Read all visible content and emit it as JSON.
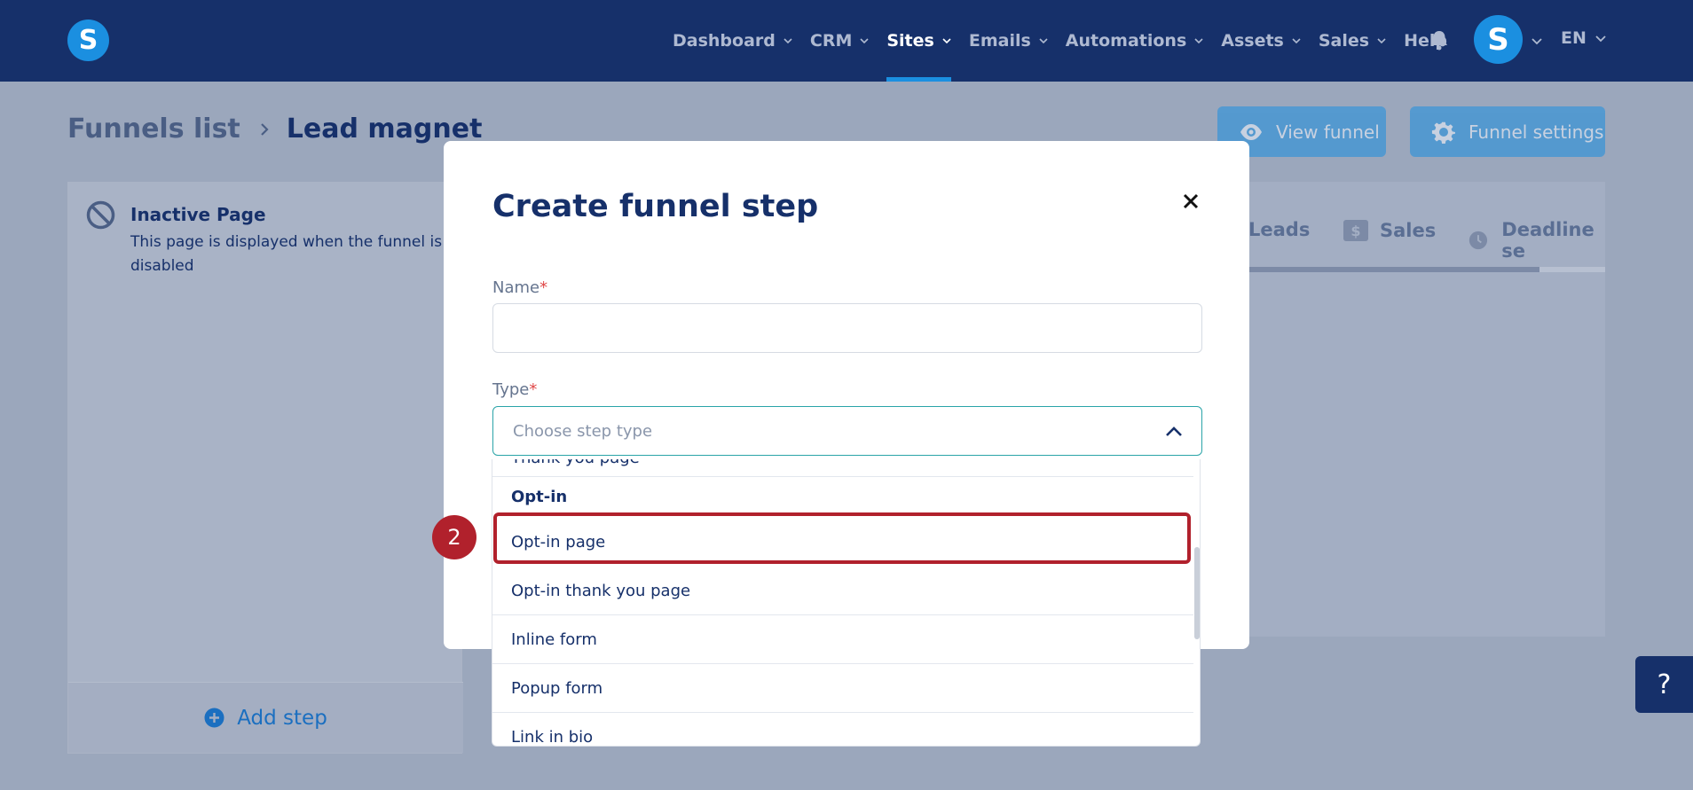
{
  "nav": {
    "items": [
      {
        "label": "Dashboard",
        "has_chevron": true
      },
      {
        "label": "CRM",
        "has_chevron": true
      },
      {
        "label": "Sites",
        "has_chevron": true,
        "active": true
      },
      {
        "label": "Emails",
        "has_chevron": true
      },
      {
        "label": "Automations",
        "has_chevron": true
      },
      {
        "label": "Assets",
        "has_chevron": true
      },
      {
        "label": "Sales",
        "has_chevron": true
      },
      {
        "label": "Help",
        "has_chevron": false
      }
    ],
    "logo_letter": "S",
    "avatar_letter": "S",
    "language": "EN",
    "icons": {
      "bell": "bell-icon"
    }
  },
  "breadcrumb": {
    "parent": "Funnels list",
    "current": "Lead magnet"
  },
  "header_buttons": {
    "view_funnel": "View funnel",
    "funnel_settings": "Funnel settings"
  },
  "left_panel": {
    "title": "Inactive Page",
    "description": "This page is displayed when the funnel is disabled",
    "add_step": "Add step"
  },
  "right_panel": {
    "tabs": [
      {
        "label": "Leads",
        "icon": "leads-icon"
      },
      {
        "label": "Sales",
        "icon": "dollar-icon"
      },
      {
        "label": "Deadline se",
        "icon": "clock-icon"
      }
    ]
  },
  "help_button": "?",
  "modal": {
    "title": "Create funnel step",
    "name_label": "Name",
    "type_label": "Type",
    "required_mark": "*",
    "name_value": "",
    "type_placeholder": "Choose step type",
    "dropdown": {
      "partial_item": "Thank you page",
      "group": "Opt-in",
      "items": [
        "Opt-in page",
        "Opt-in thank you page",
        "Inline form",
        "Popup form",
        "Link in bio"
      ]
    }
  },
  "annotation": {
    "step_number": "2"
  },
  "colors": {
    "nav_bg": "#16306a",
    "accent": "#1b8fe0",
    "highlight": "#b1212c",
    "select_border": "#2aa4a8"
  }
}
